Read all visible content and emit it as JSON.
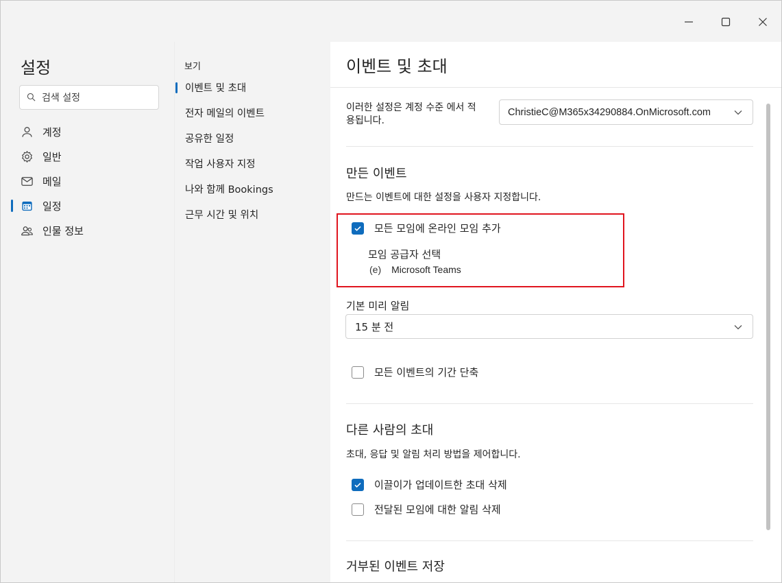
{
  "window": {
    "controls": {
      "minimize": "minimize-icon",
      "maximize": "maximize-icon",
      "close": "close-icon"
    }
  },
  "leftnav": {
    "title": "설정",
    "search_placeholder": "검색 설정",
    "items": [
      {
        "label": "계정",
        "icon": "person-icon",
        "active": false
      },
      {
        "label": "일반",
        "icon": "gear-icon",
        "active": false
      },
      {
        "label": "메일",
        "icon": "mail-icon",
        "active": false
      },
      {
        "label": "일정",
        "icon": "calendar-icon",
        "active": true
      },
      {
        "label": "인물 정보",
        "icon": "people-icon",
        "active": false
      }
    ]
  },
  "midnav": {
    "section_label": "보기",
    "items": [
      {
        "label": "이벤트 및 초대",
        "active": true
      },
      {
        "label": "전자 메일의 이벤트",
        "active": false
      },
      {
        "label": "공유한 일정",
        "active": false
      },
      {
        "label": "작업 사용자 지정",
        "active": false
      },
      {
        "label": "나와 함께 Bookings",
        "active": false
      },
      {
        "label": "근무 시간 및 위치",
        "active": false
      }
    ]
  },
  "content": {
    "title": "이벤트 및 초대",
    "account_label": "이러한 설정은 계정 수준 에서 적용됩니다.",
    "account_value": "ChristieC@M365x34290884.OnMicrosoft.com",
    "created_events": {
      "title": "만든 이벤트",
      "description": "만드는 이벤트에 대한 설정을 사용자 지정합니다.",
      "add_online_meeting": {
        "label": "모든 모임에 온라인 모임 추가",
        "checked": true
      },
      "provider_label": "모임 공급자 선택",
      "provider_icon_text": "(e)",
      "provider_value": "Microsoft Teams",
      "reminder_label": "기본 미리 알림",
      "reminder_value": "15 분 전",
      "shorten_events": {
        "label": "모든 이벤트의 기간 단축",
        "checked": false
      }
    },
    "invites_from_others": {
      "title": "다른 사람의 초대",
      "description": "초대, 응답 및 알림 처리 방법을 제어합니다.",
      "delete_updated": {
        "label": "이끌이가 업데이트한 초대 삭제",
        "checked": true
      },
      "delete_forwarded": {
        "label": "전달된 모임에 대한 알림 삭제",
        "checked": false
      }
    },
    "declined_events": {
      "title": "거부된 이벤트 저장"
    }
  },
  "colors": {
    "accent": "#0f6cbd",
    "highlight_border": "#e0141e"
  }
}
